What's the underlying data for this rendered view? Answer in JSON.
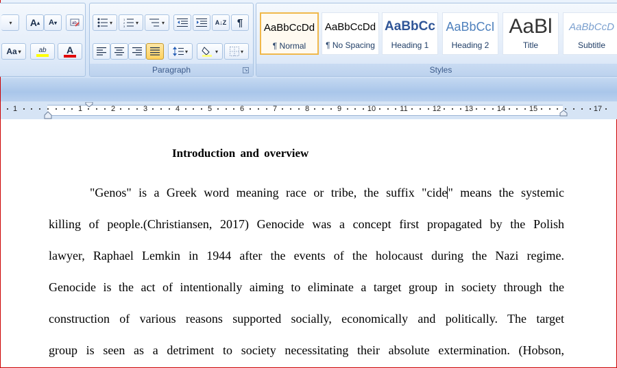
{
  "ribbon": {
    "paragraph_label": "Paragraph",
    "styles_label": "Styles",
    "font": {
      "grow_label": "A",
      "shrink_label": "A",
      "change_case_label": "Aa",
      "highlight_label": "ab",
      "font_color_label": "A",
      "highlight_color": "#ffff00",
      "font_color": "#e00000"
    },
    "paragraph": {
      "sort_label": "A↓Z",
      "pilcrow_label": "¶",
      "shading_color": "#ffff80"
    },
    "styles": [
      {
        "sample": "AaBbCcDd",
        "name": "¶ Normal"
      },
      {
        "sample": "AaBbCcDd",
        "name": "¶ No Spacing"
      },
      {
        "sample": "AaBbCc",
        "name": "Heading 1"
      },
      {
        "sample": "AaBbCcI",
        "name": "Heading 2"
      },
      {
        "sample": "AaBl",
        "name": "Title"
      },
      {
        "sample": "AaBbCcD",
        "name": "Subtitle"
      }
    ]
  },
  "ruler": {
    "numbers": [
      "1",
      "1",
      "2",
      "3",
      "4",
      "5",
      "6",
      "7",
      "8",
      "9",
      "10",
      "11",
      "12",
      "13",
      "14",
      "15",
      "17"
    ]
  },
  "document": {
    "heading": "Introduction and overview",
    "line1_before_caret": "\"Genos\" is a Greek word meaning race or tribe, the suffix \"cide",
    "line1_after_caret": "\" means the systemic",
    "lines": [
      "killing of people.(Christiansen, 2017) Genocide was a concept first propagated by the Polish",
      "lawyer, Raphael Lemkin in 1944 after the events of the holocaust during the Nazi regime.",
      "Genocide is the act of intentionally aiming to eliminate a target group in society through the",
      "construction of various reasons supported socially, economically and politically. The target",
      "group is seen as a detriment to society necessitating their absolute extermination. (Hobson,"
    ]
  }
}
